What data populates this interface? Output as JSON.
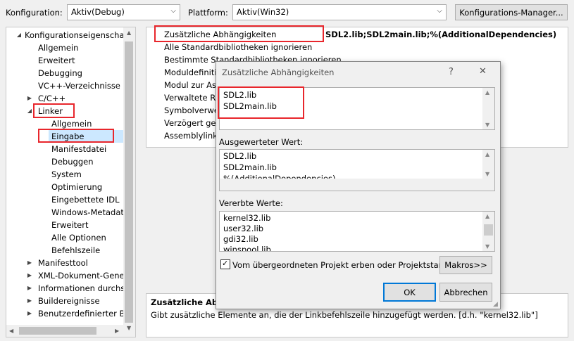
{
  "toolbar": {
    "config_label": "Konfiguration:",
    "config_value": "Aktiv(Debug)",
    "platform_label": "Plattform:",
    "platform_value": "Aktiv(Win32)",
    "config_manager_label": "Konfigurations-Manager..."
  },
  "tree": {
    "root": "Konfigurationseigenschafte",
    "items": [
      "Allgemein",
      "Erweitert",
      "Debugging",
      "VC++-Verzeichnisse",
      "C/C++",
      "Linker",
      "Allgemein",
      "Eingabe",
      "Manifestdatei",
      "Debuggen",
      "System",
      "Optimierung",
      "Eingebettete IDL",
      "Windows-Metadate",
      "Erweitert",
      "Alle Optionen",
      "Befehlszeile",
      "Manifesttool",
      "XML-Dokument-Gener",
      "Informationen durchsu",
      "Buildereignisse",
      "Benutzerdefinierter Buil"
    ]
  },
  "grid": {
    "rows": [
      {
        "name": "Zusätzliche Abhängigkeiten",
        "value": "SDL2.lib;SDL2main.lib;%(AdditionalDependencies)"
      },
      {
        "name": "Alle Standardbibliotheken ignorieren",
        "value": ""
      },
      {
        "name": "Bestimmte Standardbibliotheken ignorieren",
        "value": ""
      },
      {
        "name": "Moduldefinitionsdatei",
        "value": ""
      },
      {
        "name": "Modul zur Assembly hinzufügen",
        "value": ""
      },
      {
        "name": "Verwaltete Ressourcendatei einbetten",
        "value": ""
      },
      {
        "name": "Symbolverweise erzwingen",
        "value": ""
      },
      {
        "name": "Verzögert geladene DLLs",
        "value": ""
      },
      {
        "name": "Assemblylinkressource",
        "value": ""
      }
    ]
  },
  "description": {
    "title": "Zusätzliche Abhängigkeiten",
    "text": "Gibt zusätzliche Elemente an, die der Linkbefehlszeile hinzugefügt werden. [d.h. \"kernel32.lib\"]"
  },
  "dialog": {
    "title": "Zusätzliche Abhängigkeiten",
    "help": "?",
    "close": "✕",
    "edit_lines": [
      "SDL2.lib",
      "SDL2main.lib"
    ],
    "evaluated_label": "Ausgewerteter Wert:",
    "evaluated_lines": [
      "SDL2.lib",
      "SDL2main.lib",
      "%(AdditionalDependencies)"
    ],
    "inherited_label": "Vererbte Werte:",
    "inherited_lines": [
      "kernel32.lib",
      "user32.lib",
      "gdi32.lib",
      "winspool.lib"
    ],
    "inherit_checkbox": "Vom übergeordneten Projekt erben oder Projektstanda",
    "inherit_checked": true,
    "macros_button": "Makros>>",
    "ok_button": "OK",
    "cancel_button": "Abbrechen"
  },
  "colors": {
    "highlight": "#e8262c",
    "selection": "#cce8ff",
    "accent": "#0078d7"
  }
}
